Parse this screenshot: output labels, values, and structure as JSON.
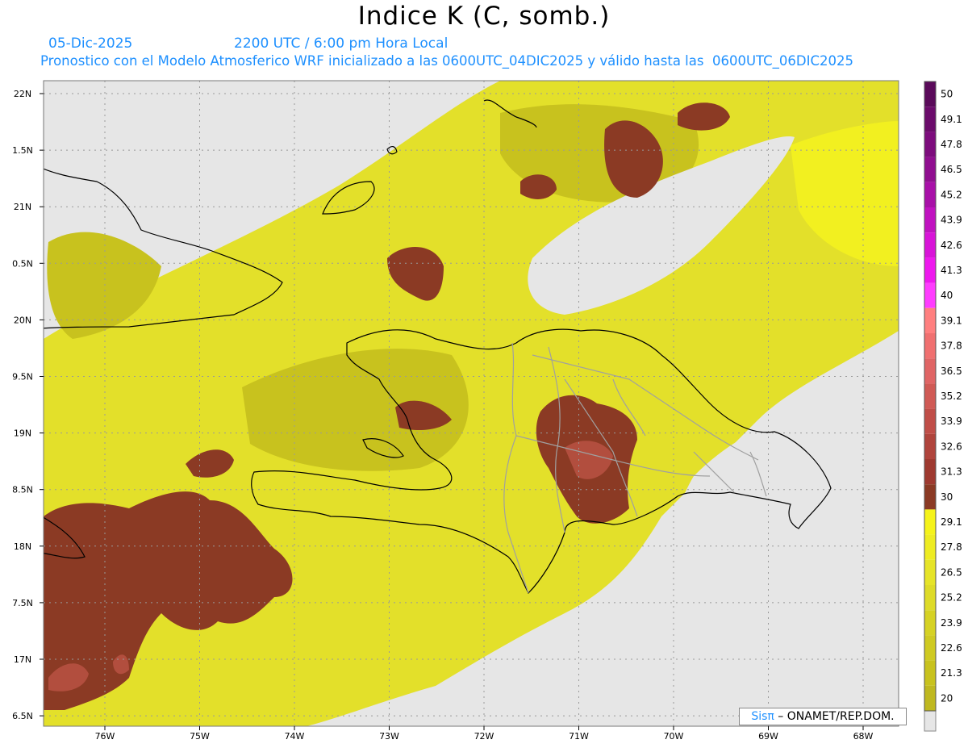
{
  "header": {
    "title": "Indice K (C, somb.)",
    "date": "05-Dic-2025",
    "time": "2200 UTC / 6:00 pm Hora Local",
    "subtitle": "Pronostico con el Modelo Atmosferico WRF inicializado a las 0600UTC_04DIC2025 y válido hasta las  0600UTC_06DIC2025"
  },
  "map": {
    "lat_labels": [
      "22N",
      "1.5N",
      "21N",
      "0.5N",
      "20N",
      "9.5N",
      "19N",
      "8.5N",
      "18N",
      "7.5N",
      "17N",
      "6.5N"
    ],
    "lon_labels": [
      "76W",
      "75W",
      "74W",
      "73W",
      "72W",
      "71W",
      "70W",
      "69W",
      "68W"
    ],
    "region": "Hispaniola / Caribbean",
    "colors": {
      "ocean_no_data": "#e6e6e6",
      "k_20": "#c8c21e",
      "k_25": "#e3e02a",
      "k_29": "#f2f020",
      "k_30": "#8b3a24",
      "k_33": "#b24e3e",
      "k_37": "#d97070"
    }
  },
  "legend": {
    "values": [
      "50",
      "49.1",
      "47.8",
      "46.5",
      "45.2",
      "43.9",
      "42.6",
      "41.3",
      "40",
      "39.1",
      "37.8",
      "36.5",
      "35.2",
      "33.9",
      "32.6",
      "31.3",
      "30",
      "29.1",
      "27.8",
      "26.5",
      "25.2",
      "23.9",
      "22.6",
      "21.3",
      "20"
    ],
    "colors": [
      "#5a0a5a",
      "#6b0b6b",
      "#7d0c7d",
      "#900e90",
      "#a810a8",
      "#c012c0",
      "#d814d8",
      "#ee18ee",
      "#ff3cff",
      "#ff7f7f",
      "#f07070",
      "#e06565",
      "#d05a55",
      "#c04e48",
      "#b0443c",
      "#9f3a30",
      "#8b3a24",
      "#f5f31a",
      "#eeec22",
      "#e6e428",
      "#dedb28",
      "#d6d224",
      "#cfca22",
      "#c8c21e",
      "#bfb820"
    ]
  },
  "credit": {
    "logo": "Sisπ",
    "text": " – ONAMET/REP.DOM."
  }
}
